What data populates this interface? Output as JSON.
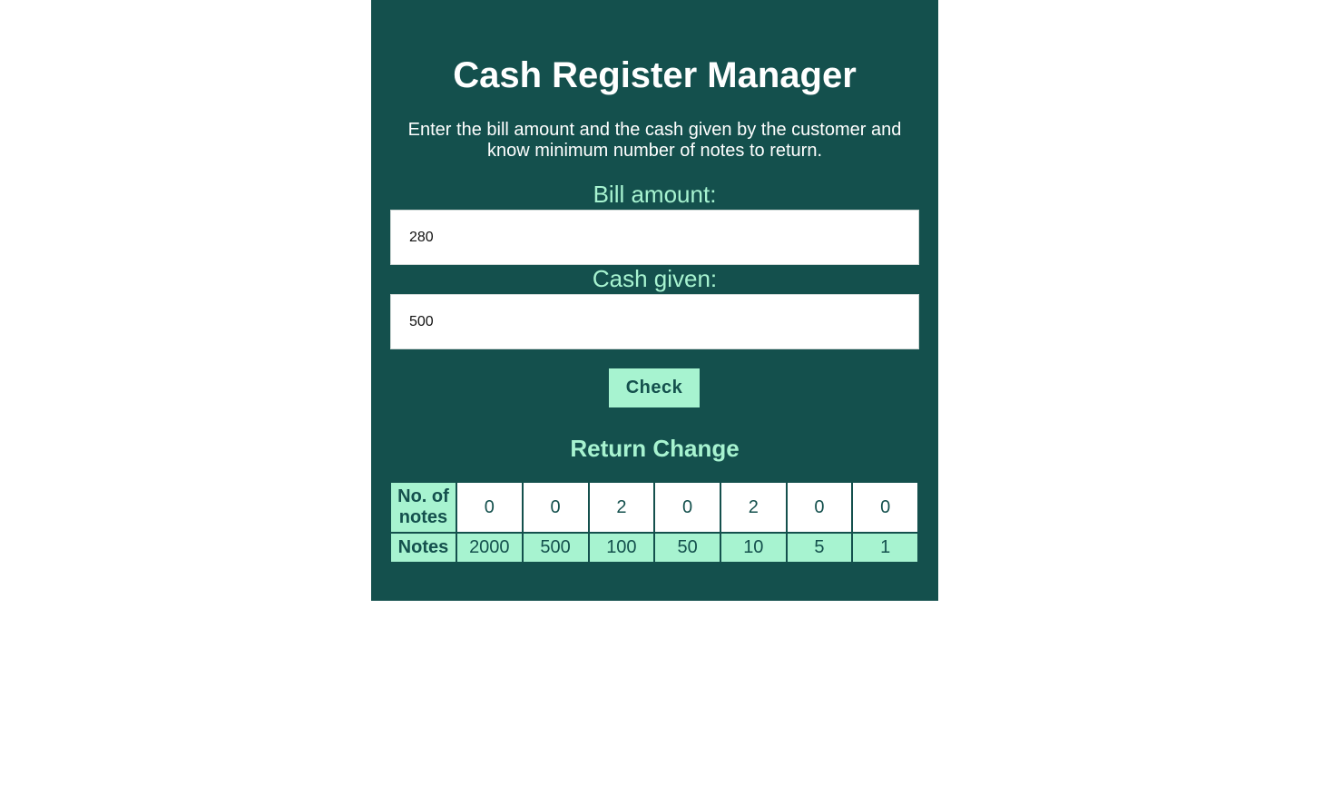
{
  "app": {
    "title": "Cash Register Manager",
    "description": "Enter the bill amount and the cash given by the customer and know minimum number of notes to return."
  },
  "form": {
    "bill_label": "Bill amount:",
    "bill_value": "280",
    "cash_label": "Cash given:",
    "cash_value": "500",
    "check_label": "Check"
  },
  "result": {
    "title": "Return Change",
    "count_header": "No. of notes",
    "notes_header": "Notes",
    "counts": [
      "0",
      "0",
      "2",
      "0",
      "2",
      "0",
      "0"
    ],
    "notes": [
      "2000",
      "500",
      "100",
      "50",
      "10",
      "5",
      "1"
    ]
  },
  "colors": {
    "panel_background": "#14504d",
    "accent": "#a7f3d0",
    "text_light": "#ffffff"
  }
}
